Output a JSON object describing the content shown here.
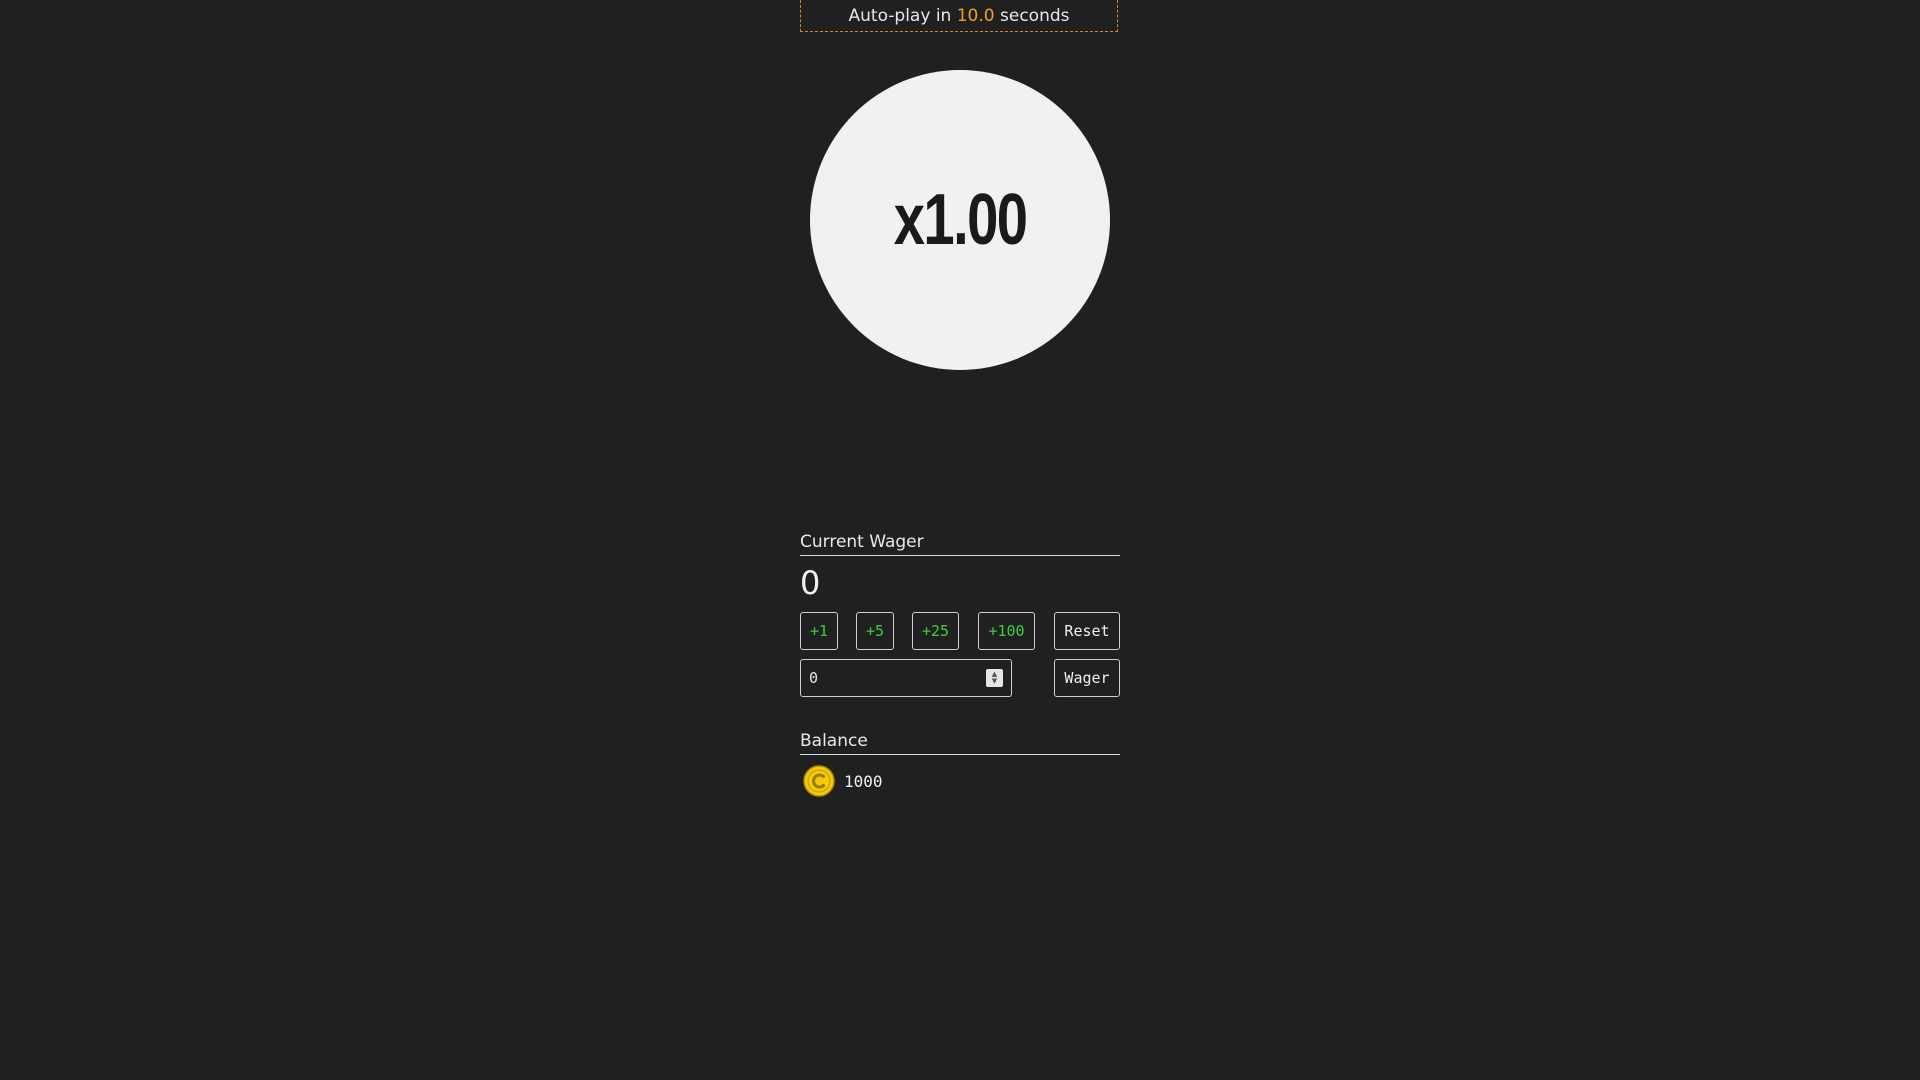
{
  "autoplay": {
    "prefix": "Auto-play in",
    "seconds": "10.0",
    "suffix": "seconds"
  },
  "multiplier": {
    "value": "x1.00"
  },
  "wager": {
    "label": "Current Wager",
    "current": "0",
    "chips": [
      "+1",
      "+5",
      "+25",
      "+100"
    ],
    "reset_label": "Reset",
    "input_value": "0",
    "submit_label": "Wager"
  },
  "balance": {
    "label": "Balance",
    "value": "1000",
    "coin_icon": "coin-icon"
  },
  "colors": {
    "background": "#202020",
    "accent_orange": "#f0a020",
    "chip_green": "#3ccf3c",
    "coin_gold": "#f2cc0c"
  }
}
